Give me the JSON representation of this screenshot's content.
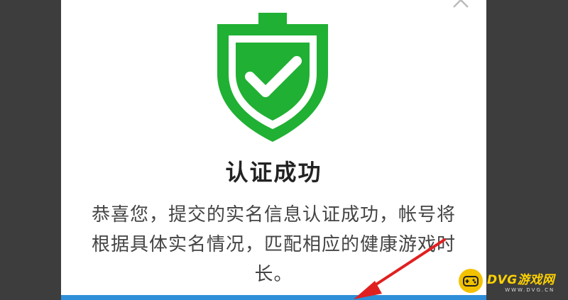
{
  "dialog": {
    "title": "认证成功",
    "message": "恭喜您，提交的实名信息认证成功，帐号将根据具体实名情况，匹配相应的健康游戏时长。",
    "close_icon": "close-icon",
    "shield_icon": "shield-check-icon"
  },
  "watermark": {
    "brand": "DVG游戏网",
    "sub": "WWW.DVG.CN"
  },
  "colors": {
    "shield_green": "#20b033",
    "accent_blue": "#2e8fd8",
    "arrow_red": "#e02020"
  }
}
